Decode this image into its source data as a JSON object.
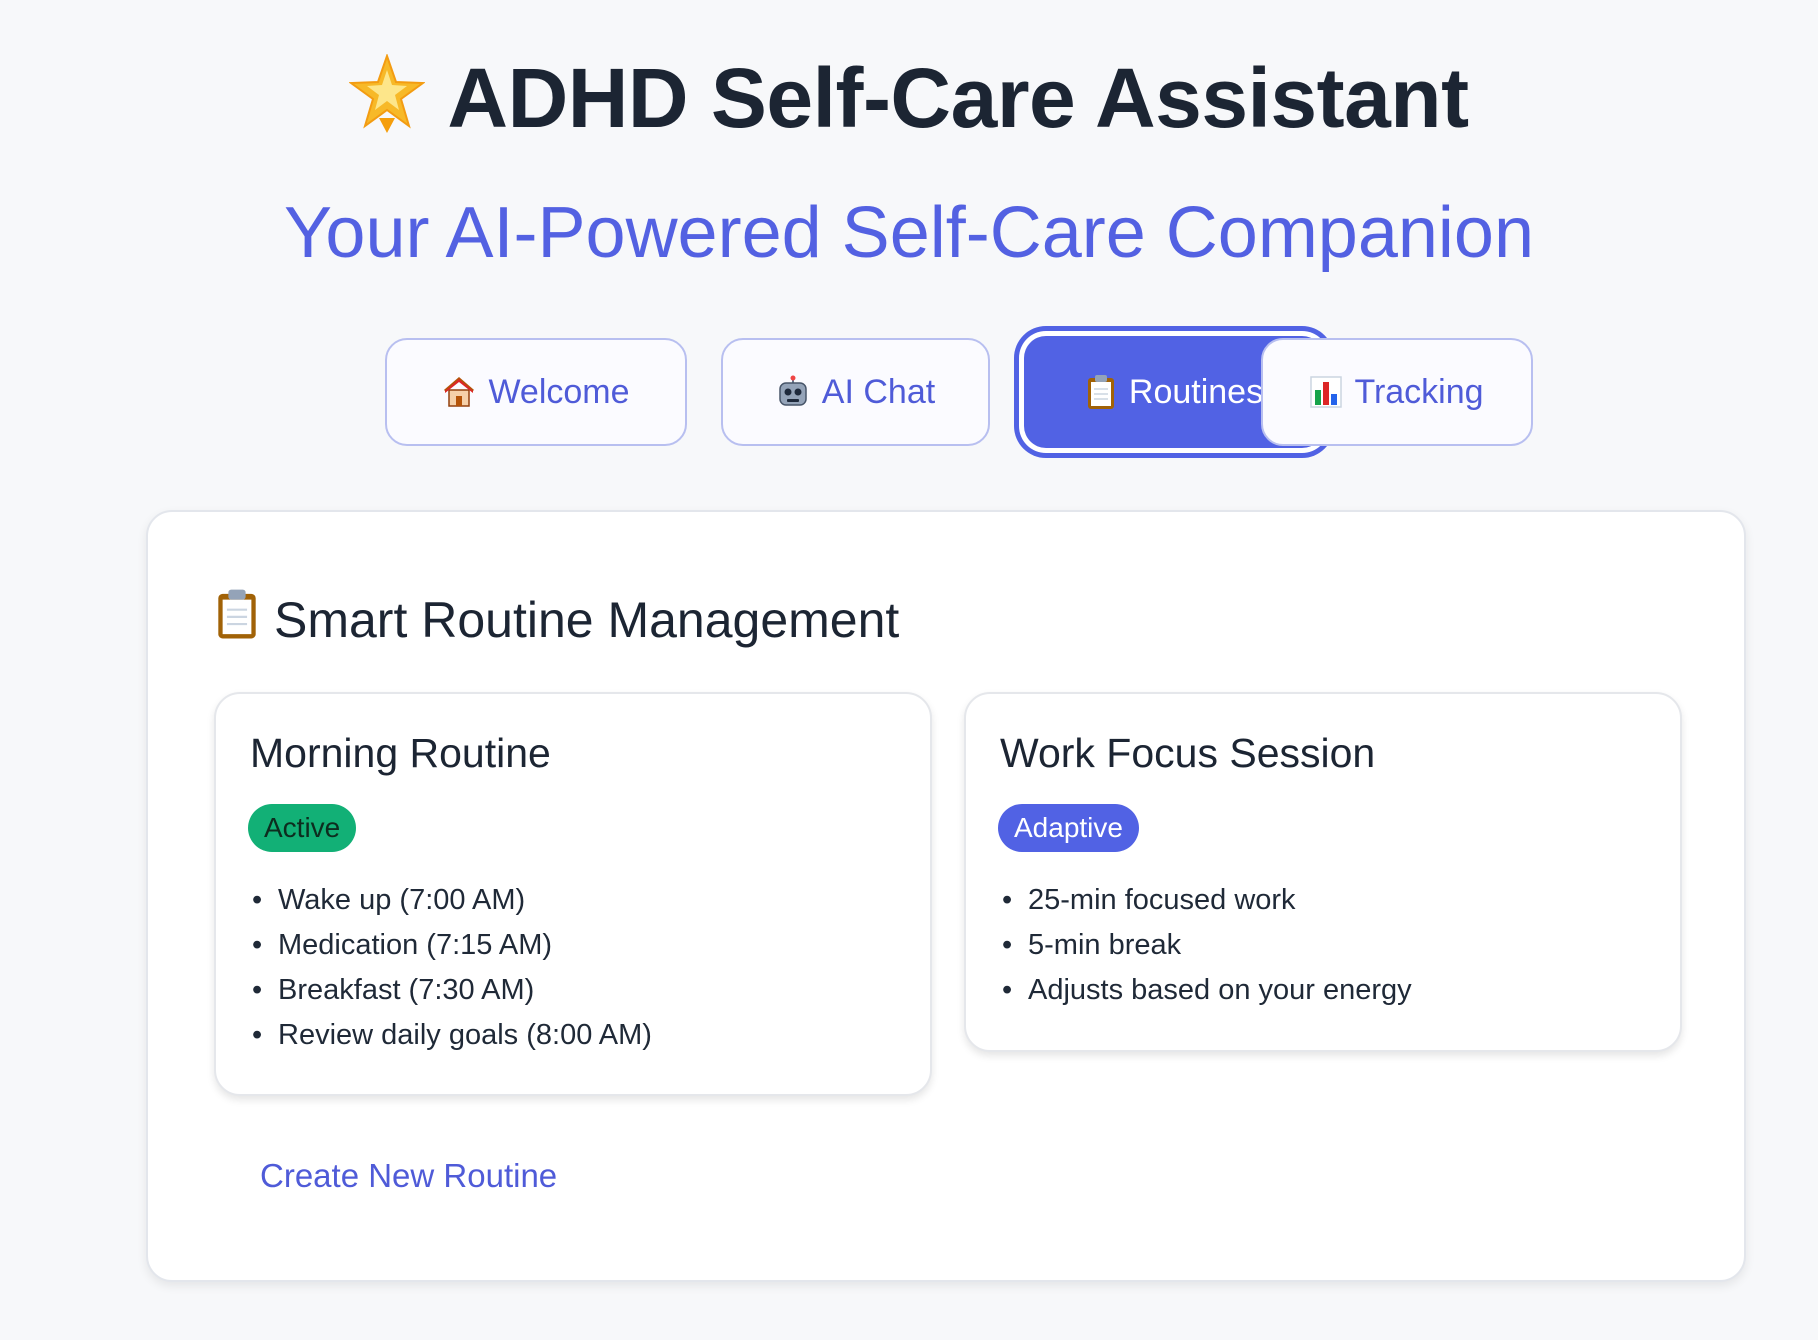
{
  "header": {
    "title": "ADHD Self-Care Assistant",
    "title_icon": "star-icon",
    "subtitle": "Your AI-Powered Self-Care Companion"
  },
  "tabs": [
    {
      "label": "Welcome",
      "icon": "house-icon",
      "active": false
    },
    {
      "label": "AI Chat",
      "icon": "robot-icon",
      "active": false
    },
    {
      "label": "Routines",
      "icon": "clipboard-icon",
      "active": true
    },
    {
      "label": "Tracking",
      "icon": "bar-chart-icon",
      "active": false
    }
  ],
  "panel": {
    "title": "Smart Routine Management",
    "title_icon": "clipboard-icon",
    "cards": [
      {
        "title": "Morning Routine",
        "badge": "Active",
        "badge_color": "#12b076",
        "steps": [
          "Wake up (7:00 AM)",
          "Medication (7:15 AM)",
          "Breakfast (7:30 AM)",
          "Review daily goals (8:00 AM)"
        ]
      },
      {
        "title": "Work Focus Session",
        "badge": "Adaptive",
        "badge_color": "#5162e4",
        "steps": [
          "25-min focused work",
          "5-min break",
          "Adjusts based on your energy"
        ]
      }
    ],
    "create_label": "Create New Routine"
  },
  "colors": {
    "accent": "#5162e4",
    "text_dark": "#1c2533",
    "background": "#f7f8fa"
  }
}
